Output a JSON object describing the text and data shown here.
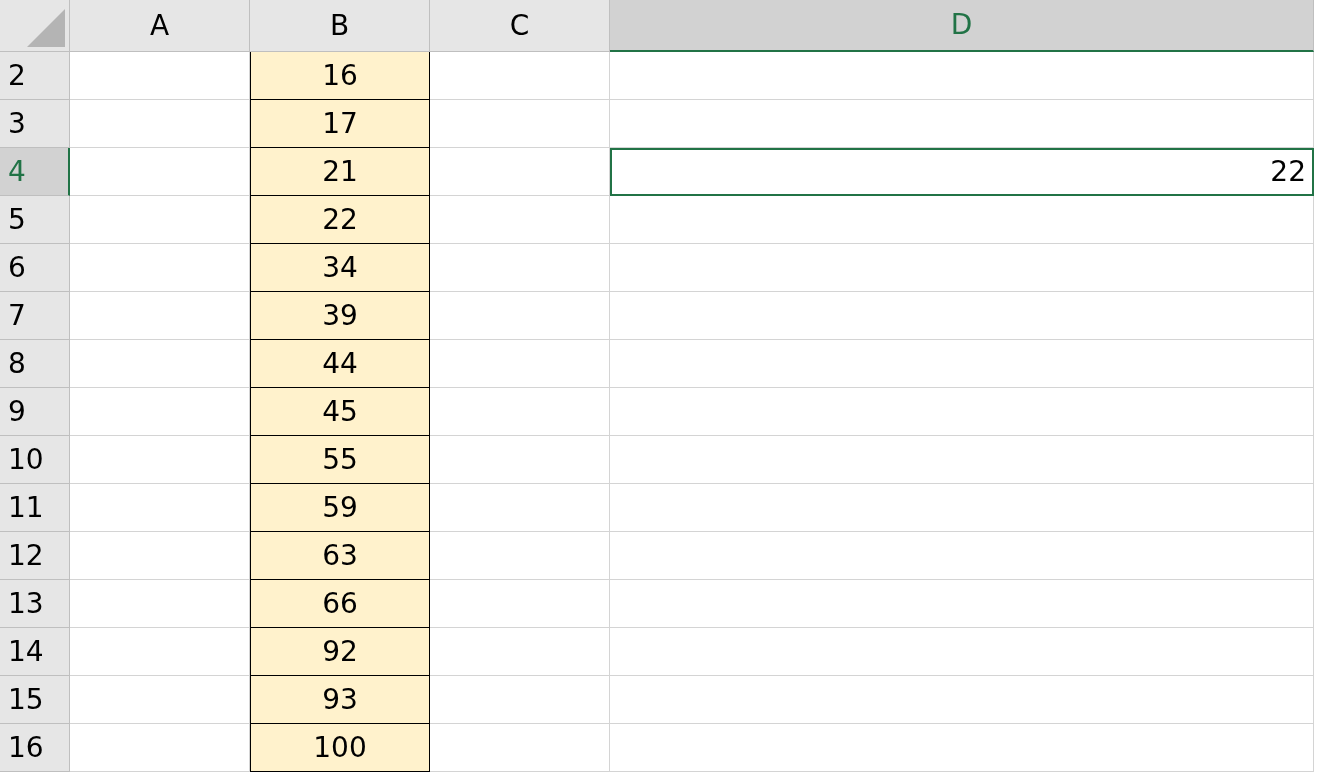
{
  "columns": [
    {
      "label": "A",
      "selected": false,
      "filled": false
    },
    {
      "label": "B",
      "selected": false,
      "filled": true
    },
    {
      "label": "C",
      "selected": false,
      "filled": false
    },
    {
      "label": "D",
      "selected": true,
      "filled": false
    }
  ],
  "rows": [
    {
      "header": "2",
      "selected": false,
      "b": "16"
    },
    {
      "header": "3",
      "selected": false,
      "b": "17"
    },
    {
      "header": "4",
      "selected": true,
      "b": "21",
      "d": "22"
    },
    {
      "header": "5",
      "selected": false,
      "b": "22"
    },
    {
      "header": "6",
      "selected": false,
      "b": "34"
    },
    {
      "header": "7",
      "selected": false,
      "b": "39"
    },
    {
      "header": "8",
      "selected": false,
      "b": "44"
    },
    {
      "header": "9",
      "selected": false,
      "b": "45"
    },
    {
      "header": "10",
      "selected": false,
      "b": "55"
    },
    {
      "header": "11",
      "selected": false,
      "b": "59"
    },
    {
      "header": "12",
      "selected": false,
      "b": "63"
    },
    {
      "header": "13",
      "selected": false,
      "b": "66"
    },
    {
      "header": "14",
      "selected": false,
      "b": "92"
    },
    {
      "header": "15",
      "selected": false,
      "b": "93"
    },
    {
      "header": "16",
      "selected": false,
      "b": "100"
    }
  ]
}
